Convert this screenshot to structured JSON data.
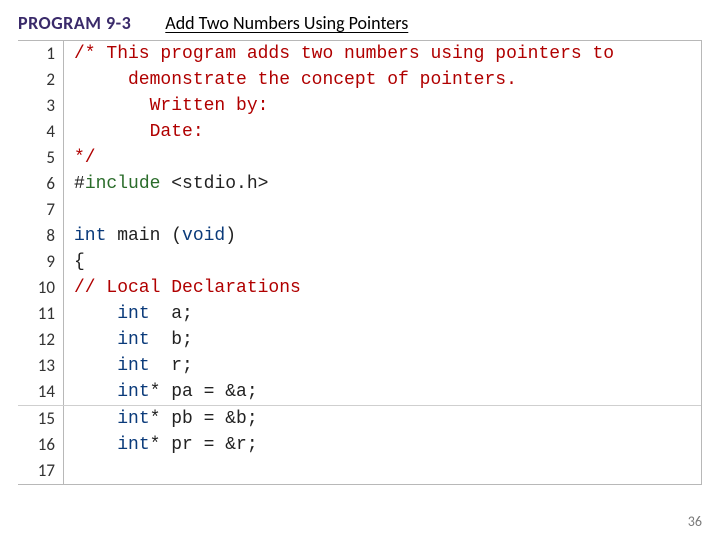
{
  "header": {
    "program_label": "PROGRAM 9-3",
    "title": "Add Two Numbers Using Pointers"
  },
  "code": {
    "lines": [
      {
        "n": 1,
        "tokens": [
          {
            "cls": "tok-comment",
            "t": "/* This program adds two numbers using pointers to"
          }
        ]
      },
      {
        "n": 2,
        "tokens": [
          {
            "cls": "tok-comment",
            "t": "     demonstrate the concept of pointers."
          }
        ]
      },
      {
        "n": 3,
        "tokens": [
          {
            "cls": "tok-comment",
            "t": "       Written by:"
          }
        ]
      },
      {
        "n": 4,
        "tokens": [
          {
            "cls": "tok-comment",
            "t": "       Date:"
          }
        ]
      },
      {
        "n": 5,
        "tokens": [
          {
            "cls": "tok-comment",
            "t": "*/"
          }
        ]
      },
      {
        "n": 6,
        "tokens": [
          {
            "cls": "tok-plain",
            "t": "#"
          },
          {
            "cls": "tok-pre",
            "t": "include"
          },
          {
            "cls": "tok-plain",
            "t": " <stdio.h>"
          }
        ]
      },
      {
        "n": 7,
        "tokens": [
          {
            "cls": "tok-plain",
            "t": ""
          }
        ]
      },
      {
        "n": 8,
        "tokens": [
          {
            "cls": "tok-keyword",
            "t": "int"
          },
          {
            "cls": "tok-plain",
            "t": " main ("
          },
          {
            "cls": "tok-keyword",
            "t": "void"
          },
          {
            "cls": "tok-plain",
            "t": ")"
          }
        ]
      },
      {
        "n": 9,
        "tokens": [
          {
            "cls": "tok-plain",
            "t": "{"
          }
        ]
      },
      {
        "n": 10,
        "tokens": [
          {
            "cls": "tok-comment",
            "t": "// Local Declarations"
          }
        ]
      },
      {
        "n": 11,
        "tokens": [
          {
            "cls": "tok-plain",
            "t": "    "
          },
          {
            "cls": "tok-keyword",
            "t": "int"
          },
          {
            "cls": "tok-plain",
            "t": "  a;"
          }
        ]
      },
      {
        "n": 12,
        "tokens": [
          {
            "cls": "tok-plain",
            "t": "    "
          },
          {
            "cls": "tok-keyword",
            "t": "int"
          },
          {
            "cls": "tok-plain",
            "t": "  b;"
          }
        ]
      },
      {
        "n": 13,
        "tokens": [
          {
            "cls": "tok-plain",
            "t": "    "
          },
          {
            "cls": "tok-keyword",
            "t": "int"
          },
          {
            "cls": "tok-plain",
            "t": "  r;"
          }
        ]
      },
      {
        "n": 14,
        "tokens": [
          {
            "cls": "tok-plain",
            "t": "    "
          },
          {
            "cls": "tok-keyword",
            "t": "int"
          },
          {
            "cls": "tok-plain",
            "t": "* pa = &a;"
          }
        ]
      },
      {
        "n": 15,
        "tokens": [
          {
            "cls": "tok-plain",
            "t": "    "
          },
          {
            "cls": "tok-keyword",
            "t": "int"
          },
          {
            "cls": "tok-plain",
            "t": "* pb = &b;"
          }
        ]
      },
      {
        "n": 16,
        "tokens": [
          {
            "cls": "tok-plain",
            "t": "    "
          },
          {
            "cls": "tok-keyword",
            "t": "int"
          },
          {
            "cls": "tok-plain",
            "t": "* pr = &r;"
          }
        ]
      },
      {
        "n": 17,
        "tokens": [
          {
            "cls": "tok-plain",
            "t": ""
          }
        ]
      }
    ],
    "separator_before_line": 15
  },
  "page_number": "36"
}
